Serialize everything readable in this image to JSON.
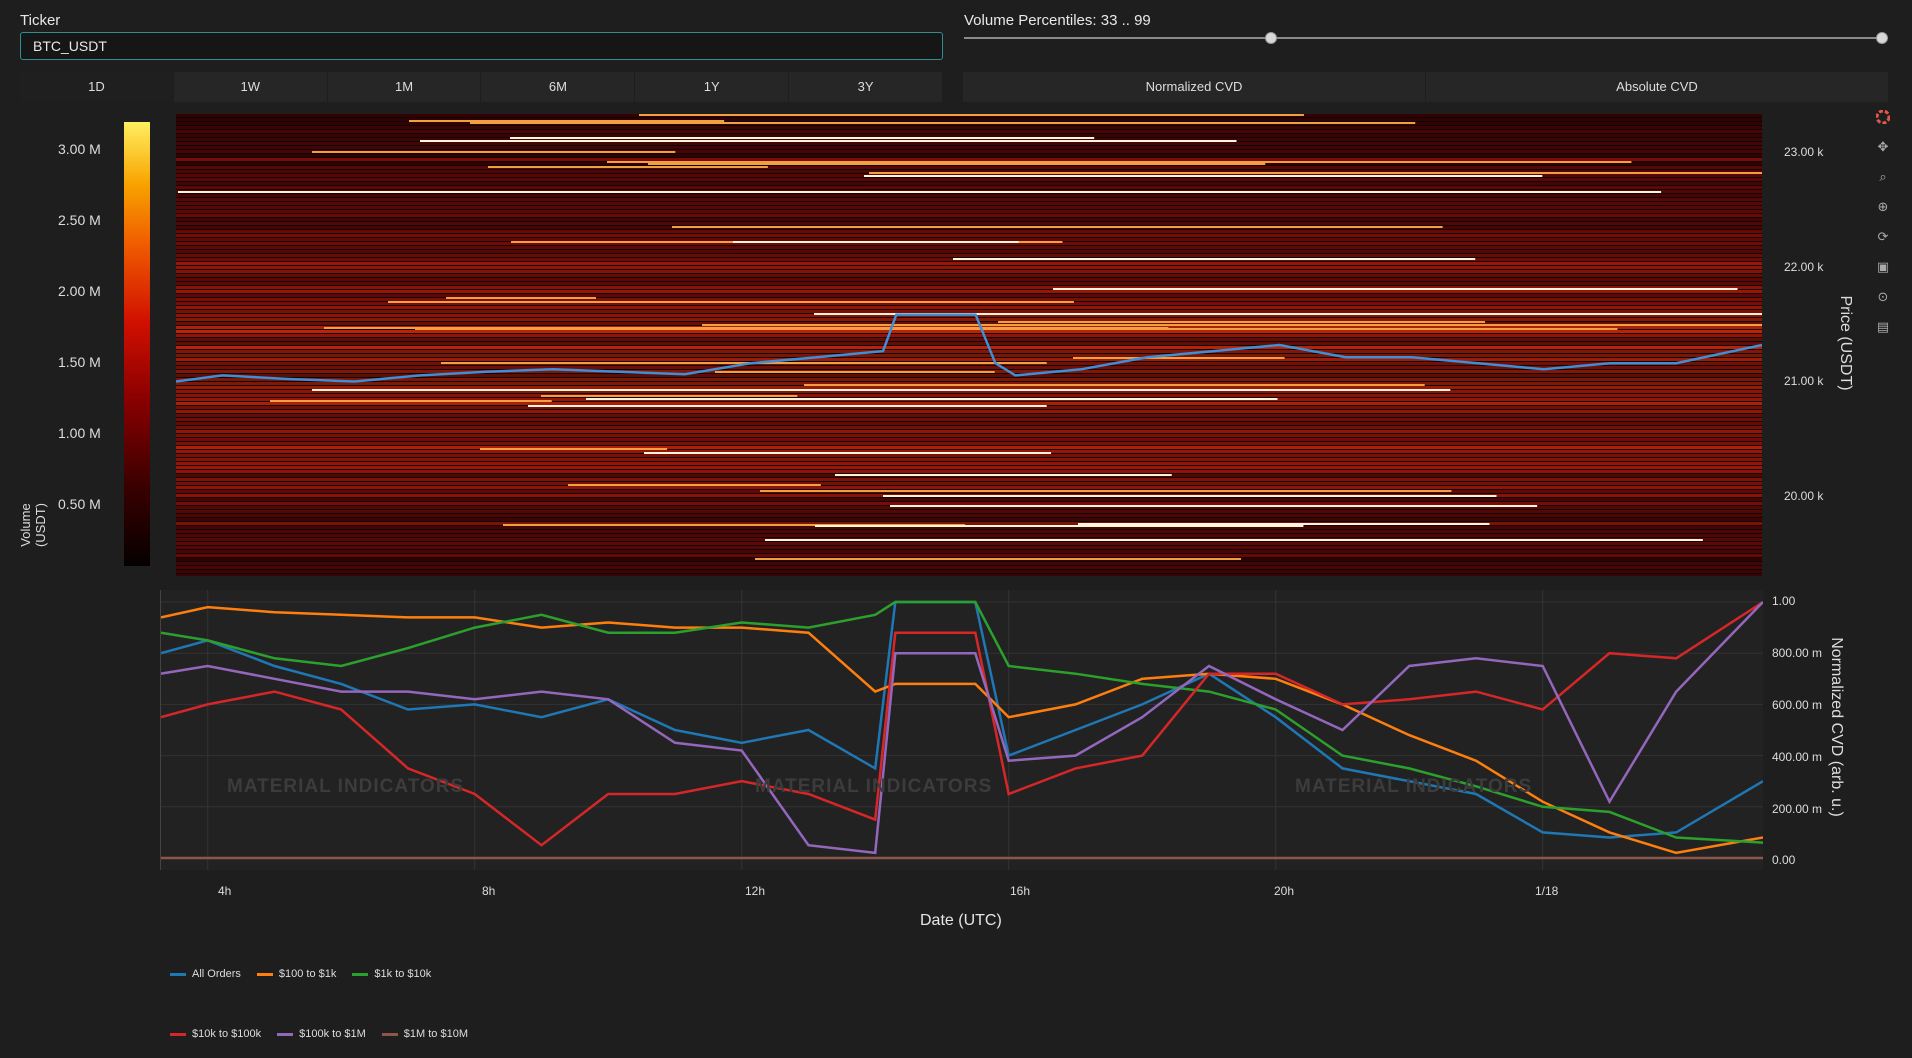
{
  "ticker": {
    "label": "Ticker",
    "value": "BTC_USDT"
  },
  "volume_percentiles": {
    "label": "Volume Percentiles: 33 .. 99",
    "low": 33,
    "high": 99
  },
  "range_buttons": [
    "1D",
    "1W",
    "1M",
    "6M",
    "1Y",
    "3Y"
  ],
  "cvd_buttons": [
    "Normalized CVD",
    "Absolute CVD"
  ],
  "heatmap": {
    "colorbar_title": "Volume (USDT)",
    "colorbar_ticks": [
      "3.00 M",
      "2.50 M",
      "2.00 M",
      "1.50 M",
      "1.00 M",
      "0.50 M"
    ],
    "price_ticks": [
      "23.00 k",
      "22.00 k",
      "21.00 k",
      "20.00 k"
    ],
    "price_title": "Price (USDT)"
  },
  "cvd": {
    "y_title": "Normalized CVD (arb. u.)",
    "y_ticks": [
      "1.00",
      "800.00 m",
      "600.00 m",
      "400.00 m",
      "200.00 m",
      "0.00"
    ],
    "x_ticks": [
      "4h",
      "8h",
      "12h",
      "16h",
      "20h",
      "1/18"
    ],
    "x_title": "Date (UTC)"
  },
  "watermark": "MATERIAL INDICATORS",
  "legend": [
    {
      "name": "All Orders",
      "color": "#1f77b4"
    },
    {
      "name": "$100 to $1k",
      "color": "#ff7f0e"
    },
    {
      "name": "$1k to $10k",
      "color": "#2ca02c"
    },
    {
      "name": "$10k to $100k",
      "color": "#d62728"
    },
    {
      "name": "$100k to $1M",
      "color": "#9467bd"
    },
    {
      "name": "$1M to $10M",
      "color": "#8c564b"
    }
  ],
  "toolbar_icons": [
    "plotly-logo-icon",
    "pan-icon",
    "zoom-icon",
    "zoom-in-out-icon",
    "reset-icon",
    "save-icon",
    "crosshair-icon",
    "comment-icon"
  ],
  "chart_data": [
    {
      "type": "heatmap",
      "title": "",
      "ylabel": "Price (USDT)",
      "ylim": [
        19500,
        23300
      ],
      "colorbar": {
        "label": "Volume (USDT)",
        "range": [
          0,
          3200000
        ]
      },
      "series": [
        {
          "name": "Price",
          "x": [
            3.3,
            4,
            5,
            6,
            7,
            8,
            9,
            10,
            11,
            12,
            13,
            14,
            14.2,
            14.6,
            15,
            15.4,
            15.7,
            16,
            17,
            18,
            19,
            20,
            21,
            22,
            23,
            24,
            25,
            26,
            27.3
          ],
          "values": [
            21100,
            21150,
            21120,
            21100,
            21150,
            21180,
            21200,
            21180,
            21160,
            21250,
            21300,
            21350,
            21650,
            21650,
            21650,
            21650,
            21250,
            21150,
            21200,
            21300,
            21350,
            21400,
            21300,
            21300,
            21250,
            21200,
            21250,
            21250,
            21400
          ]
        }
      ]
    },
    {
      "type": "line",
      "title": "",
      "xlabel": "Date (UTC)",
      "ylabel": "Normalized CVD (arb. u.)",
      "ylim": [
        0,
        1.0
      ],
      "x": [
        3.3,
        4,
        5,
        6,
        7,
        8,
        9,
        10,
        11,
        12,
        13,
        14,
        14.3,
        15,
        15.5,
        16,
        17,
        18,
        19,
        20,
        21,
        22,
        23,
        24,
        25,
        26,
        27.3
      ],
      "series": [
        {
          "name": "All Orders",
          "values": [
            0.8,
            0.85,
            0.75,
            0.68,
            0.58,
            0.6,
            0.55,
            0.62,
            0.5,
            0.45,
            0.5,
            0.35,
            1.0,
            1.0,
            1.0,
            0.4,
            0.5,
            0.6,
            0.72,
            0.55,
            0.35,
            0.3,
            0.25,
            0.1,
            0.08,
            0.1,
            0.3
          ]
        },
        {
          "name": "$100 to $1k",
          "values": [
            0.94,
            0.98,
            0.96,
            0.95,
            0.94,
            0.94,
            0.9,
            0.92,
            0.9,
            0.9,
            0.88,
            0.65,
            0.68,
            0.68,
            0.68,
            0.55,
            0.6,
            0.7,
            0.72,
            0.7,
            0.6,
            0.48,
            0.38,
            0.22,
            0.1,
            0.02,
            0.08
          ]
        },
        {
          "name": "$1k to $10k",
          "values": [
            0.88,
            0.85,
            0.78,
            0.75,
            0.82,
            0.9,
            0.95,
            0.88,
            0.88,
            0.92,
            0.9,
            0.95,
            1.0,
            1.0,
            1.0,
            0.75,
            0.72,
            0.68,
            0.65,
            0.58,
            0.4,
            0.35,
            0.28,
            0.2,
            0.18,
            0.08,
            0.06
          ]
        },
        {
          "name": "$10k to $100k",
          "values": [
            0.55,
            0.6,
            0.65,
            0.58,
            0.35,
            0.25,
            0.05,
            0.25,
            0.25,
            0.3,
            0.25,
            0.15,
            0.88,
            0.88,
            0.88,
            0.25,
            0.35,
            0.4,
            0.72,
            0.72,
            0.6,
            0.62,
            0.65,
            0.58,
            0.8,
            0.78,
            1.0
          ]
        },
        {
          "name": "$100k to $1M",
          "values": [
            0.72,
            0.75,
            0.7,
            0.65,
            0.65,
            0.62,
            0.65,
            0.62,
            0.45,
            0.42,
            0.05,
            0.02,
            0.8,
            0.8,
            0.8,
            0.38,
            0.4,
            0.55,
            0.75,
            0.62,
            0.5,
            0.75,
            0.78,
            0.75,
            0.22,
            0.65,
            1.0
          ]
        },
        {
          "name": "$1M to $10M",
          "values": [
            0.0,
            0.0,
            0.0,
            0.0,
            0.0,
            0.0,
            0.0,
            0.0,
            0.0,
            0.0,
            0.0,
            0.0,
            0.0,
            0.0,
            0.0,
            0.0,
            0.0,
            0.0,
            0.0,
            0.0,
            0.0,
            0.0,
            0.0,
            0.0,
            0.0,
            0.0,
            0.0
          ]
        }
      ]
    }
  ]
}
